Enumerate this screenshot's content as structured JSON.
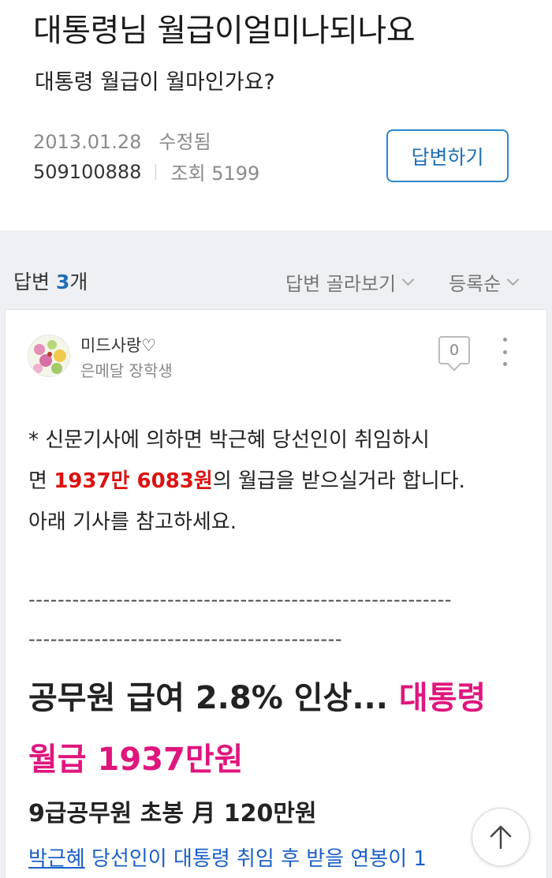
{
  "question": {
    "title": "대통령님 월급이얼미나되나요",
    "body": "대통령 월급이 월마인가요?",
    "date": "2013.01.28",
    "edited": "수정됨",
    "author_id": "509100888",
    "views": "조회 5199",
    "answer_button": "답변하기"
  },
  "answers_header": {
    "label": "답변",
    "count": "3",
    "unit": "개",
    "filter_pick": "답변 골라보기",
    "sort": "등록순"
  },
  "answer": {
    "user_name": "미드사랑♡",
    "user_badge": "은메달 장학생",
    "like_count": "0",
    "line1": "* 신문기사에 의하면 박근혜 당선인이 취임하시",
    "line2_pre": "면 ",
    "line2_red": "1937만 6083원",
    "line2_post": "의 월급을 받으실거라 합니다.",
    "line3": "아래 기사를 참고하세요.",
    "dash_line1": "----------------------------------------------------------",
    "dash_line2": "-------------------------------------------",
    "headline_black": "공무원 급여 2.8% 인상... ",
    "headline_pink1": "대통령",
    "headline_pink2": "월급 1937만원",
    "sub_headline": "9급공무원 초봉 月 120만원",
    "link_word": "박근혜",
    "link_rest": " 당선인이 대통령 취임 후 받을 연봉이 1"
  },
  "colors": {
    "accent": "#1f6fb5",
    "red": "#dd1111",
    "pink": "#e0157d",
    "gray_bg": "#eef0f3"
  },
  "icons": [
    "ellipsis-vertical-icon",
    "chevron-down-icon",
    "arrow-up-icon",
    "speech-bubble-icon"
  ]
}
